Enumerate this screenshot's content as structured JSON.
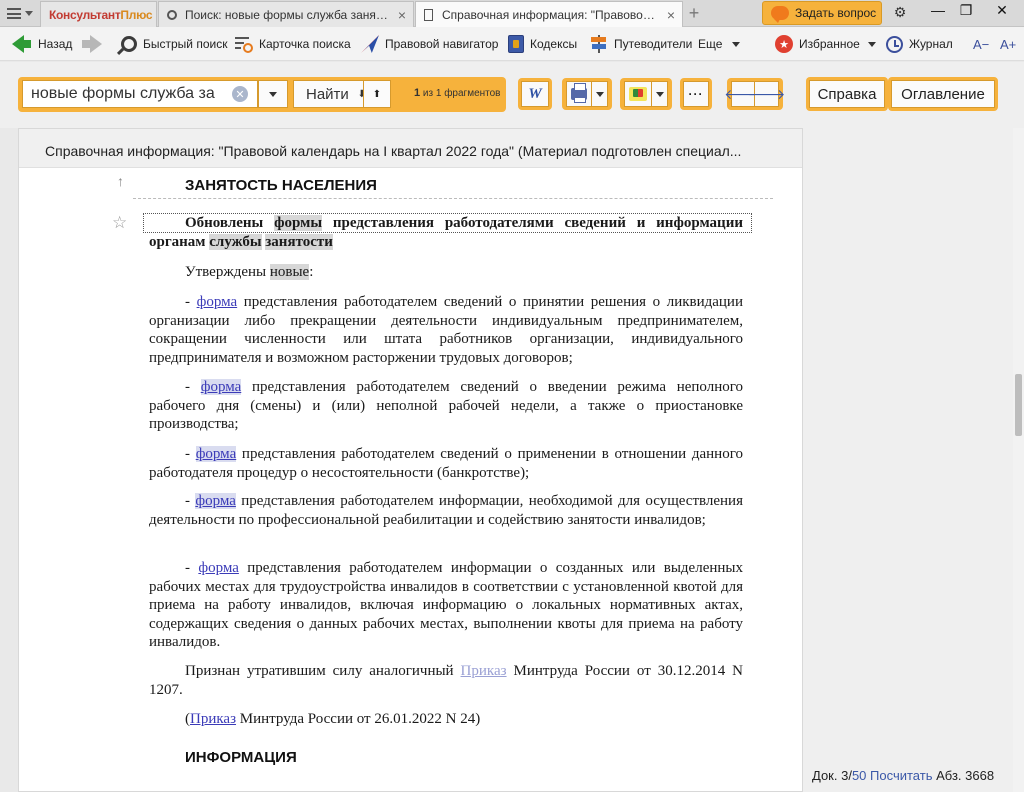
{
  "tabbar": {
    "logo_left": "Консультант",
    "logo_right": "Плюс",
    "tab1_title": "Поиск: новые формы служба занятости",
    "tab2_title": "Справочная информация: \"Правовой кал",
    "close_glyph": "×",
    "new_tab_glyph": "+",
    "ask_label": "Задать вопрос"
  },
  "toolbar": {
    "back": "Назад",
    "quick_search": "Быстрый поиск",
    "search_card": "Карточка поиска",
    "legal_navigator": "Правовой навигатор",
    "codexes": "Кодексы",
    "guides": "Путеводители",
    "more": "Еще",
    "favorites": "Избранное",
    "journal": "Журнал",
    "font_smaller": "A−",
    "font_larger": "A+"
  },
  "search": {
    "value": "новые формы служба за",
    "find_label": "Найти",
    "fragments_current": "1",
    "fragments_text": "из 1 фрагментов"
  },
  "side_buttons": {
    "help": "Справка",
    "contents": "Оглавление"
  },
  "document": {
    "header": "Справочная информация: \"Правовой календарь на I квартал 2022 года\" (Материал подготовлен специал...",
    "section1": "ЗАНЯТОСТЬ НАСЕЛЕНИЯ",
    "title_p1": "Обновлены ",
    "title_h1": "формы",
    "title_p2": " представления работодателями сведений и информации органам ",
    "title_h2": "службы",
    "title_p3": " ",
    "title_h3": "занятости",
    "approved_p1": "Утверждены ",
    "approved_h": "новые",
    "approved_p2": ":",
    "dash": "- ",
    "form_link": "форма",
    "item1": " представления работодателем сведений о принятии решения о ликвидации организации либо прекращении деятельности индивидуальным предпринимателем, сокращении численности или штата работников организации, индивидуального предпринимателя и возможном расторжении трудовых договоров;",
    "item2": " представления работодателем сведений о введении режима неполного рабочего дня (смены) и (или) неполной рабочей недели, а также о приостановке производства;",
    "item3": " представления работодателем сведений о применении в отношении данного работодателя процедур о несостоятельности (банкротстве);",
    "item4": " представления работодателем информации, необходимой для осуществления деятельности по профессиональной реабилитации и содействию занятости инвалидов;",
    "item5": " представления работодателем информации о созданных или выделенных рабочих местах для трудоустройства инвалидов в соответствии с установленной квотой для приема на работу инвалидов, включая информацию о локальных нормативных актах, содержащих сведения о данных рабочих местах, выполнении квоты для приема на работу инвалидов.",
    "repealed_p1": "Признан утратившим силу аналогичный ",
    "repealed_link": "Приказ",
    "repealed_p2": " Минтруда России от 30.12.2014 N 1207.",
    "source_p1": "(",
    "source_link": "Приказ",
    "source_p2": " Минтруда России от 26.01.2022 N 24)",
    "section2": "ИНФОРМАЦИЯ"
  },
  "status": {
    "doc_label": "Док. 3/",
    "doc_total": "50",
    "count_link": "Посчитать",
    "paragraph": "Абз. 3668"
  }
}
